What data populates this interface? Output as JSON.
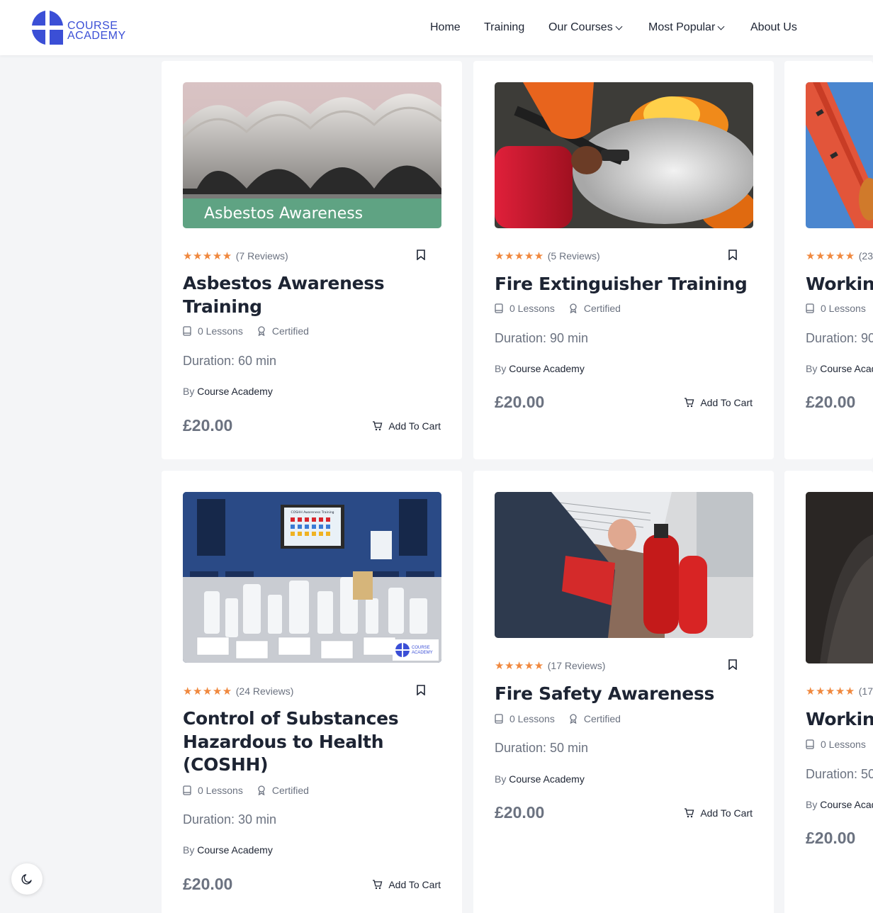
{
  "brand": {
    "line1": "COURSE",
    "line2": "ACADEMY",
    "color": "#3b4fd6"
  },
  "nav": {
    "home": "Home",
    "training": "Training",
    "our_courses": "Our Courses",
    "most_popular": "Most Popular",
    "about": "About Us"
  },
  "accent": {
    "star": "#f0883e",
    "text": "#1d2433",
    "muted": "#6b7280"
  },
  "courses": [
    {
      "thumb_caption": "Asbestos Awareness",
      "reviews": "(7 Reviews)",
      "title_l1": "Asbestos Awareness",
      "title_l2": "Training",
      "lessons": "0 Lessons",
      "certified": "Certified",
      "duration": "Duration: 60 min",
      "by": "By",
      "author": "Course Academy",
      "price": "£20.00",
      "cart": "Add To Cart",
      "rating": 5
    },
    {
      "reviews": "(5 Reviews)",
      "title_l1": "Fire Extinguisher Training",
      "lessons": "0 Lessons",
      "certified": "Certified",
      "duration": "Duration: 90 min",
      "by": "By",
      "author": "Course Academy",
      "price": "£20.00",
      "cart": "Add To Cart",
      "rating": 5
    },
    {
      "reviews": "(23",
      "title_l1": "Working",
      "lessons": "0 Lessons",
      "duration": "Duration: 90",
      "by": "By",
      "author": "Course Acad",
      "price": "£20.00",
      "rating": 5
    },
    {
      "screen_caption": "COSHH Awareness Training",
      "badge_l1": "COURSE",
      "badge_l2": "ACADEMY",
      "reviews": "(24 Reviews)",
      "title_l1": "Control of Substances",
      "title_l2": "Hazardous to Health",
      "title_l3": "(COSHH)",
      "lessons": "0 Lessons",
      "certified": "Certified",
      "duration": "Duration: 30 min",
      "by": "By",
      "author": "Course Academy",
      "price": "£20.00",
      "cart": "Add To Cart",
      "rating": 5
    },
    {
      "reviews": "(17 Reviews)",
      "title_l1": "Fire Safety Awareness",
      "lessons": "0 Lessons",
      "certified": "Certified",
      "duration": "Duration: 50 min",
      "by": "By",
      "author": "Course Academy",
      "price": "£20.00",
      "cart": "Add To Cart",
      "rating": 5
    },
    {
      "reviews": "(17",
      "title_l1": "Working",
      "lessons": "0 Lessons",
      "duration": "Duration: 50",
      "by": "By",
      "author": "Course Acad",
      "price": "£20.00",
      "rating": 5
    }
  ],
  "stars_glyph": "★★★★★",
  "icons": {
    "bookmark": "bookmark-icon",
    "cart": "cart-icon",
    "book": "book-icon",
    "award": "award-icon",
    "moon": "moon-icon"
  }
}
